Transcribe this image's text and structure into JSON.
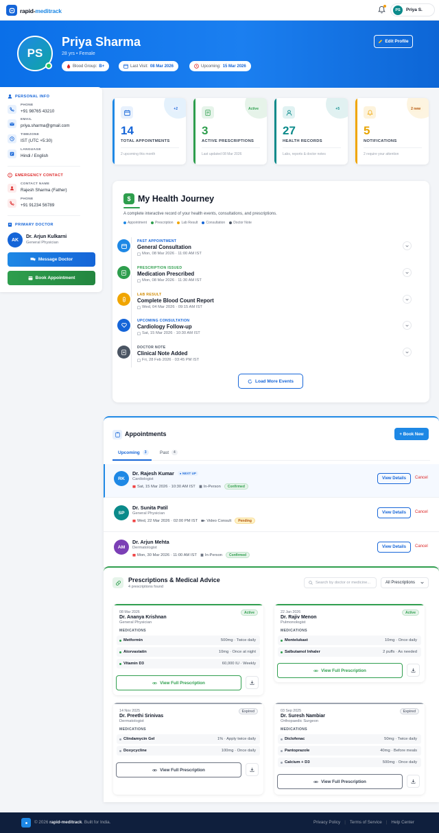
{
  "brand": {
    "name_a": "rapid-",
    "name_b": "meditrack"
  },
  "nav": {
    "user_initials": "PS",
    "user_name": "Priya S."
  },
  "profile": {
    "initials": "PS",
    "name": "Priya Sharma",
    "sub": "28 yrs • Female",
    "blood_label": "Blood Group:",
    "blood": "B+",
    "lastvisit_label": "Last Visit:",
    "lastvisit": "08 Mar 2026",
    "upcoming_label": "Upcoming:",
    "upcoming": "15 Mar 2026",
    "edit_label": "Edit Profile"
  },
  "sidebar": {
    "personal_title": "PERSONAL INFO",
    "phone_label": "PHONE",
    "phone": "+91 98765 43210",
    "email_label": "EMAIL",
    "email": "priya.sharma@gmail.com",
    "timezone_label": "TIMEZONE",
    "timezone": "IST (UTC +5:30)",
    "language_label": "LANGUAGE",
    "language": "Hindi / English",
    "emergency_title": "EMERGENCY CONTACT",
    "contact_label": "CONTACT NAME",
    "contact": "Rajesh Sharma (Father)",
    "ephone_label": "PHONE",
    "ephone": "+91 91234 56789",
    "doctor_title": "PRIMARY DOCTOR",
    "doctor_initials": "AK",
    "doctor_name": "Dr. Arjun Kulkarni",
    "doctor_role": "General Physician",
    "message_label": "Message Doctor",
    "book_label": "Book Appointment"
  },
  "stats": [
    {
      "num": "14",
      "label": "TOTAL APPOINTMENTS",
      "sub": "2 upcoming this month",
      "badge": "+2"
    },
    {
      "num": "3",
      "label": "ACTIVE PRESCRIPTIONS",
      "sub": "Last updated 08 Mar 2026",
      "badge": "Active"
    },
    {
      "num": "27",
      "label": "HEALTH RECORDS",
      "sub": "Labs, reports & doctor notes",
      "badge": "+5"
    },
    {
      "num": "5",
      "label": "NOTIFICATIONS",
      "sub": "2 require your attention",
      "badge": "2 new"
    }
  ],
  "journey": {
    "title": "My Health Journey",
    "desc": "A complete interactive record of your health events, consultations, and prescriptions.",
    "legend": [
      "Appointment",
      "Prescription",
      "Lab Result",
      "Consultation",
      "Doctor Note"
    ],
    "events": [
      {
        "type": "PAST APPOINTMENT",
        "title": "General Consultation",
        "date": "Mon, 08 Mar 2026 · 11:00 AM IST"
      },
      {
        "type": "PRESCRIPTION ISSUED",
        "title": "Medication Prescribed",
        "date": "Mon, 08 Mar 2026 · 11:30 AM IST"
      },
      {
        "type": "LAB RESULT",
        "title": "Complete Blood Count Report",
        "date": "Wed, 04 Mar 2026 · 09:15 AM IST"
      },
      {
        "type": "UPCOMING CONSULTATION",
        "title": "Cardiology Follow-up",
        "date": "Sat, 15 Mar 2026 · 10:30 AM IST"
      },
      {
        "type": "DOCTOR NOTE",
        "title": "Clinical Note Added",
        "date": "Fri, 28 Feb 2026 · 03:45 PM IST"
      }
    ],
    "load_more": "Load More Events"
  },
  "appointments": {
    "title": "Appointments",
    "new_label": "+ Book New",
    "tab_upcoming": "Upcoming",
    "tab_upcoming_count": "3",
    "tab_past": "Past",
    "tab_past_count": "4",
    "next_up": "● NEXT UP",
    "view_label": "View Details",
    "cancel_label": "Cancel",
    "rows": [
      {
        "initials": "RK",
        "name": "Dr. Rajesh Kumar",
        "spec": "Cardiologist",
        "date": "Sat, 15 Mar 2026 · 10:30 AM IST",
        "mode": "In-Person",
        "status": "Confirmed"
      },
      {
        "initials": "SP",
        "name": "Dr. Sunita Patil",
        "spec": "General Physician",
        "date": "Wed, 22 Mar 2026 · 02:00 PM IST",
        "mode": "Video Consult",
        "status": "Pending"
      },
      {
        "initials": "AM",
        "name": "Dr. Arjun Mehta",
        "spec": "Dermatologist",
        "date": "Mon, 30 Mar 2026 · 11:00 AM IST",
        "mode": "In-Person",
        "status": "Confirmed"
      }
    ]
  },
  "prescriptions": {
    "title": "Prescriptions & Medical Advice",
    "count": "4 prescriptions found",
    "search_placeholder": "Search by doctor or medicine...",
    "filter": "All Prescriptions",
    "meds_label": "MEDICATIONS",
    "view_label": "View Full Prescription",
    "cards": [
      {
        "date": "08 Mar 2026",
        "doctor": "Dr. Ananya Krishnan",
        "spec": "General Physician",
        "status": "Active",
        "meds": [
          {
            "name": "Metformin",
            "dose": "500mg · Twice daily"
          },
          {
            "name": "Atorvastatin",
            "dose": "10mg · Once at night"
          },
          {
            "name": "Vitamin D3",
            "dose": "60,000 IU · Weekly"
          }
        ]
      },
      {
        "date": "22 Jan 2026",
        "doctor": "Dr. Rajiv Menon",
        "spec": "Pulmonologist",
        "status": "Active",
        "meds": [
          {
            "name": "Montelukast",
            "dose": "10mg · Once daily"
          },
          {
            "name": "Salbutamol Inhaler",
            "dose": "2 puffs · As needed"
          }
        ]
      },
      {
        "date": "14 Nov 2025",
        "doctor": "Dr. Preethi Srinivas",
        "spec": "Dermatologist",
        "status": "Expired",
        "meds": [
          {
            "name": "Clindamycin Gel",
            "dose": "1% · Apply twice daily"
          },
          {
            "name": "Doxycycline",
            "dose": "100mg · Once daily"
          }
        ]
      },
      {
        "date": "03 Sep 2025",
        "doctor": "Dr. Suresh Nambiar",
        "spec": "Orthopaedic Surgeon",
        "status": "Expired",
        "meds": [
          {
            "name": "Diclofenac",
            "dose": "50mg · Twice daily"
          },
          {
            "name": "Pantoprazole",
            "dose": "40mg · Before meals"
          },
          {
            "name": "Calcium + D3",
            "dose": "500mg · Once daily"
          }
        ]
      }
    ]
  },
  "footer": {
    "copy_a": "© 2026 ",
    "copy_b": "rapid-meditrack",
    "copy_c": ". Built for India.",
    "links": [
      "Privacy Policy",
      "Terms of Service",
      "Help Center"
    ]
  },
  "colors": {
    "primary": "#1565d8",
    "green": "#2e9e4d",
    "teal": "#0b8a8a",
    "amber": "#f0a500",
    "danger": "#dc2626"
  }
}
